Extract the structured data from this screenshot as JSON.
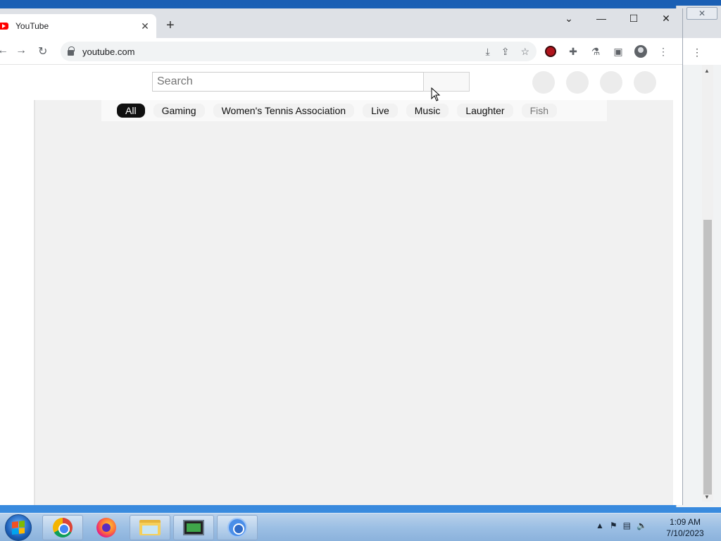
{
  "browser": {
    "tab_title": "YouTube",
    "tab_close": "✕",
    "new_tab": "+",
    "url": "youtube.com",
    "window_controls": {
      "dropdown": "⌄",
      "minimize": "—",
      "maximize": "☐",
      "close": "✕"
    },
    "nav": {
      "back": "←",
      "forward": "→",
      "reload": "↻"
    },
    "omnibox_icons": [
      "download-icon",
      "share-icon",
      "star-icon"
    ],
    "extension_icons": [
      "red-extension-icon",
      "puzzle-icon",
      "flask-icon",
      "side-panel-icon",
      "profile-icon",
      "menu-icon"
    ]
  },
  "youtube": {
    "search_placeholder": "Search",
    "chips": [
      "All",
      "Gaming",
      "Women's Tennis Association",
      "Live",
      "Music",
      "Laughter",
      "Fish"
    ],
    "active_chip": "All"
  },
  "taskbar": {
    "apps": [
      "Google Chrome",
      "Firefox",
      "Windows Explorer",
      "Task Manager",
      "Chromium"
    ],
    "time": "1:09 AM",
    "date": "7/10/2023"
  }
}
